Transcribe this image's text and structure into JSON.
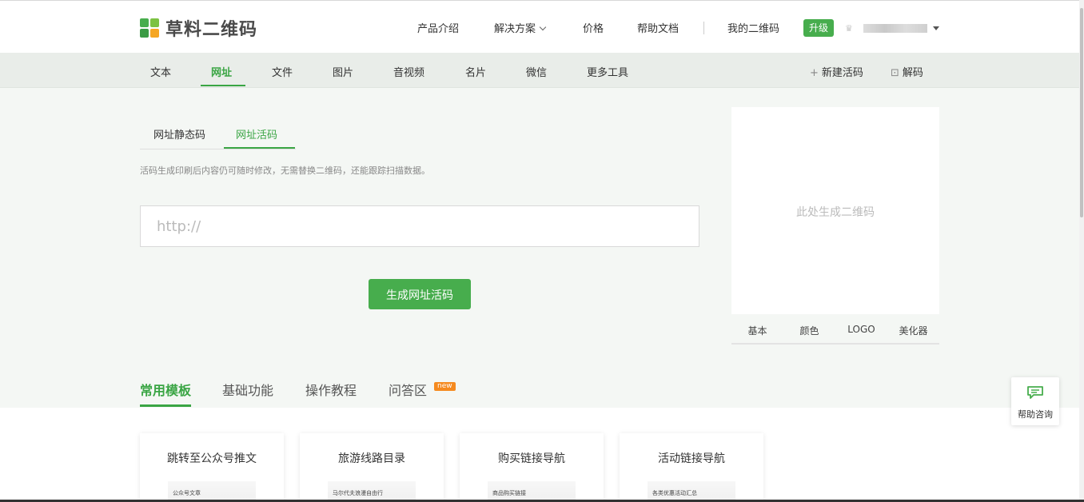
{
  "brand": {
    "name": "草料二维码",
    "colors": [
      "#47ad4d",
      "#7cc242",
      "#3a9b44",
      "#f5a623"
    ]
  },
  "topnav": {
    "items": [
      "产品介绍",
      "解决方案",
      "价格",
      "帮助文档",
      "我的二维码"
    ],
    "upgrade_label": "升级",
    "crown_icon": "crown-icon"
  },
  "subnav": {
    "tabs": [
      "文本",
      "网址",
      "文件",
      "图片",
      "音视频",
      "名片",
      "微信",
      "更多工具"
    ],
    "active_tab": "网址",
    "new_code_label": "新建活码",
    "decode_label": "解码"
  },
  "main": {
    "mode_tabs": [
      "网址静态码",
      "网址活码"
    ],
    "active_mode": "网址活码",
    "hint": "活码生成印刷后内容仍可随时修改，无需替换二维码，还能跟踪扫描数据。",
    "url_placeholder": "http://",
    "url_value": "",
    "generate_button": "生成网址活码"
  },
  "qr_panel": {
    "placeholder": "此处生成二维码",
    "tabs": [
      "基本",
      "颜色",
      "LOGO",
      "美化器"
    ]
  },
  "section_tabs": {
    "items": [
      "常用模板",
      "基础功能",
      "操作教程",
      "问答区"
    ],
    "active": "常用模板",
    "new_badge": "new"
  },
  "templates": [
    {
      "title": "跳转至公众号推文",
      "preview": "公众号文章"
    },
    {
      "title": "旅游线路目录",
      "preview": "马尔代夫浪漫自由行"
    },
    {
      "title": "购买链接导航",
      "preview": "商品购买链接"
    },
    {
      "title": "活动链接导航",
      "preview": "各类优惠活动汇总"
    }
  ],
  "help_float": {
    "label": "帮助咨询"
  },
  "accent_color": "#3aa544"
}
